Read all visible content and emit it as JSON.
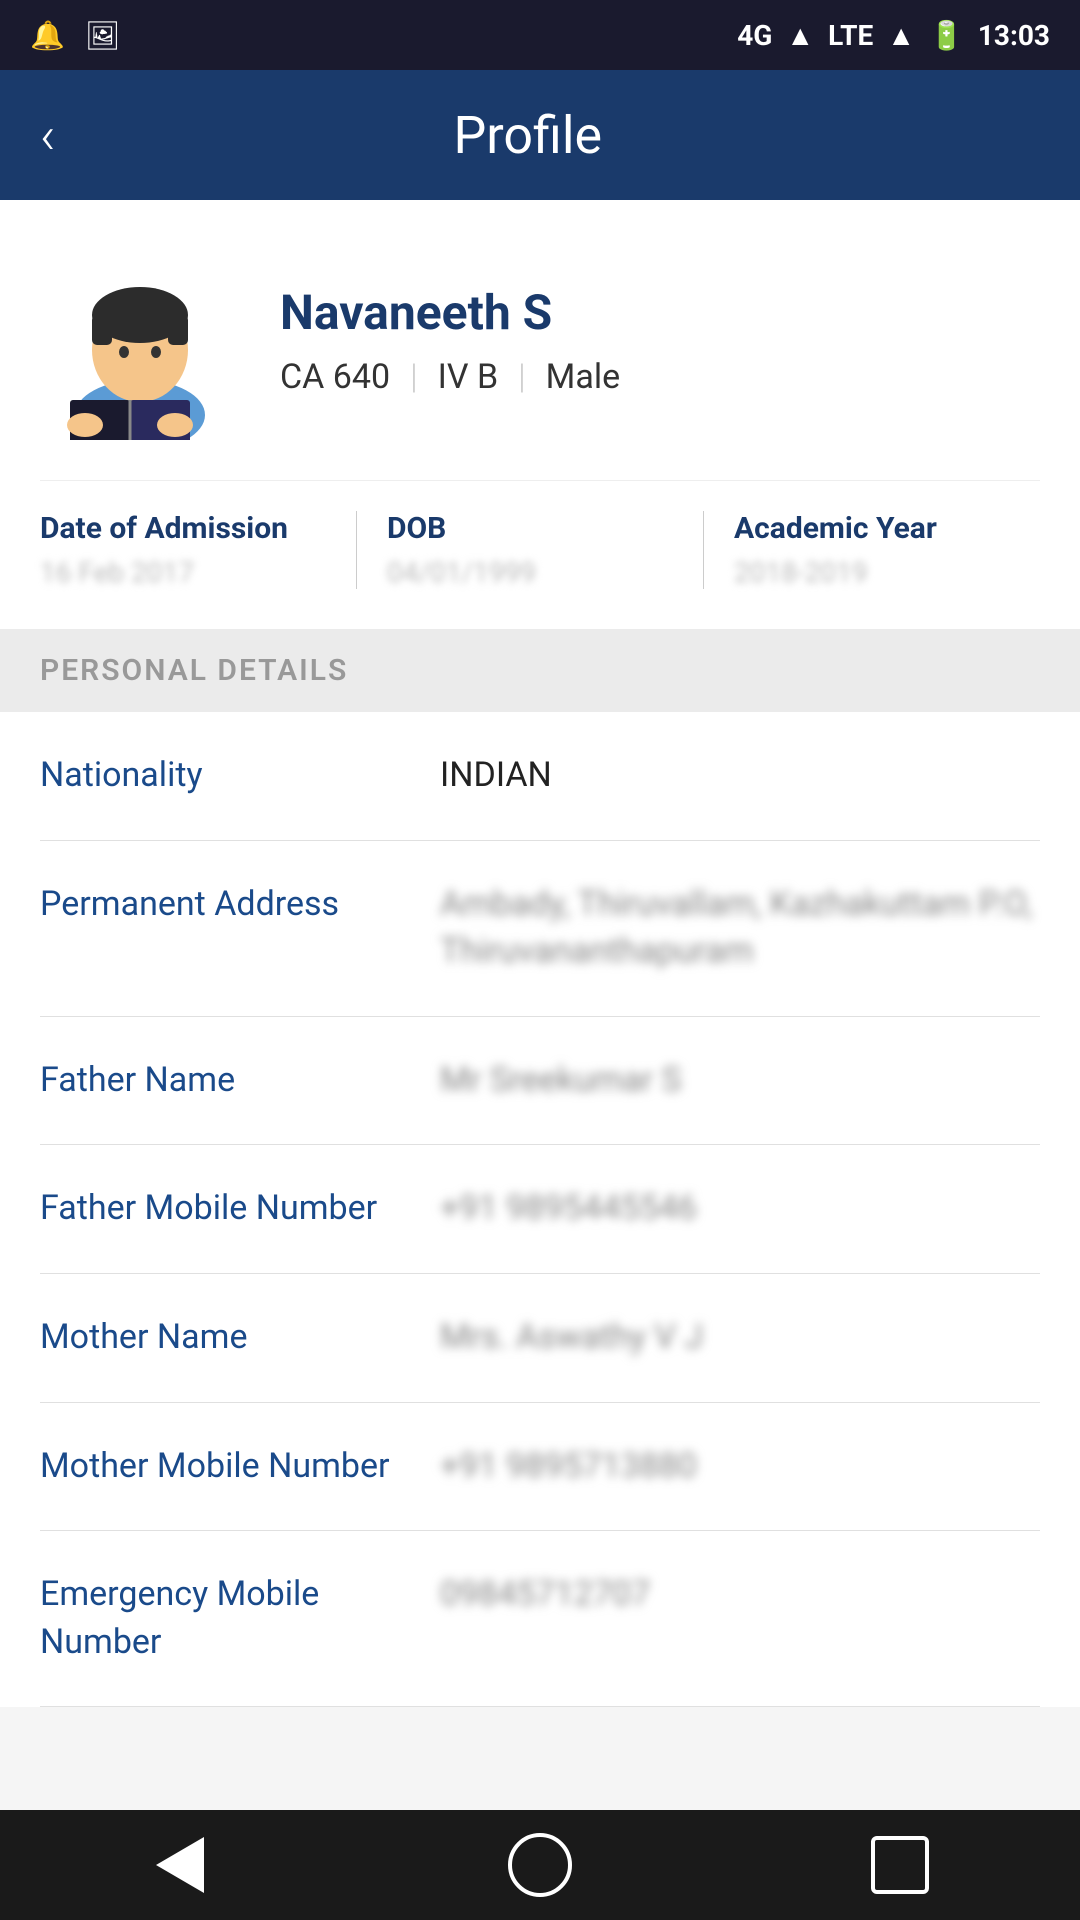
{
  "statusBar": {
    "time": "13:03",
    "signal": "4G",
    "lte": "LTE"
  },
  "header": {
    "title": "Profile",
    "back_label": "<"
  },
  "profile": {
    "name": "Navaneeth S",
    "roll": "CA 640",
    "section": "IV B",
    "gender": "Male",
    "avatar_alt": "student avatar",
    "dateOfAdmission": {
      "label": "Date of Admission",
      "value": "16 Feb 2017"
    },
    "dob": {
      "label": "DOB",
      "value": "04/01/1999"
    },
    "academicYear": {
      "label": "Academic Year",
      "value": "2018-2019"
    }
  },
  "personalDetails": {
    "sectionLabel": "PERSONAL DETAILS",
    "items": [
      {
        "label": "Nationality",
        "value": "INDIAN",
        "blurred": false
      },
      {
        "label": "Permanent Address",
        "value": "Ambady, Thiruvallam, Kazhakuttam P.O, Thiruvananthapuram",
        "blurred": true
      },
      {
        "label": "Father Name",
        "value": "Mr Sreekumar S",
        "blurred": true
      },
      {
        "label": "Father Mobile Number",
        "value": "+91 9895445546",
        "blurred": true
      },
      {
        "label": "Mother Name",
        "value": "Mrs. Aswathy V J",
        "blurred": true
      },
      {
        "label": "Mother Mobile Number",
        "value": "+91 9895713880",
        "blurred": true
      },
      {
        "label": "Emergency Mobile Number",
        "value": "09845712707",
        "blurred": true
      }
    ]
  },
  "navBar": {
    "back": "back",
    "home": "home",
    "recent": "recent"
  }
}
